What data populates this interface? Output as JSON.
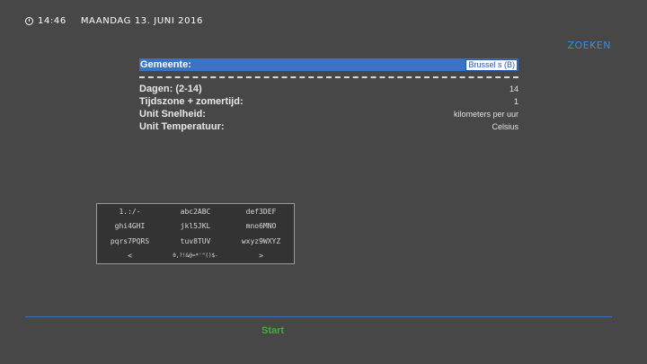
{
  "header": {
    "time": "14:46",
    "date": "MAANDAG 13. JUNI 2016"
  },
  "search_label": "ZOEKEN",
  "settings": {
    "municipality": {
      "label": "Gemeente:",
      "value": "Brussel s (B)"
    },
    "rows": [
      {
        "label": "Dagen: (2-14)",
        "value": "14"
      },
      {
        "label": "Tijdszone + zomertijd:",
        "value": "1"
      },
      {
        "label": "Unit Snelheid:",
        "value": "kilometers per uur"
      },
      {
        "label": "Unit Temperatuur:",
        "value": "Celsius"
      }
    ]
  },
  "keyboard": {
    "keys": [
      "1.:/-",
      "abc2ABC",
      "def3DEF",
      "ghi4GHI",
      "jkl5JKL",
      "mno6MNO",
      "pqrs7PQRS",
      "tuv8TUV",
      "wxyz9WXYZ",
      "<",
      "0,?!&@=*'\"()$-",
      ">"
    ]
  },
  "footer": {
    "start_label": "Start"
  }
}
